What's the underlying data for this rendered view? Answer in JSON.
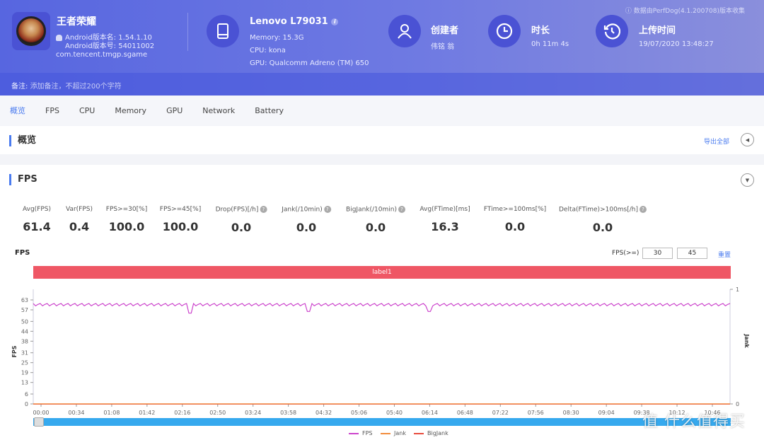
{
  "header": {
    "app": {
      "name": "王者荣耀",
      "version_name": "Android版本名: 1.54.1.10",
      "version_code": "Android版本号: 54011002",
      "package": "com.tencent.tmgp.sgame"
    },
    "device": {
      "name": "Lenovo L79031",
      "memory": "Memory: 15.3G",
      "cpu": "CPU: kona",
      "gpu": "GPU: Qualcomm Adreno (TM) 650"
    },
    "creator": {
      "title": "创建者",
      "value": "伟铭 翁"
    },
    "duration": {
      "title": "时长",
      "value": "0h 11m 4s"
    },
    "upload": {
      "title": "上传时间",
      "value": "19/07/2020 13:48:27"
    },
    "perfdog_note": "数据由PerfDog(4.1.200708)版本收集",
    "note_label": "备注:",
    "note_placeholder": "添加备注，不超过200个字符"
  },
  "tabs": [
    {
      "label": "概览",
      "active": true
    },
    {
      "label": "FPS",
      "active": false
    },
    {
      "label": "CPU",
      "active": false
    },
    {
      "label": "Memory",
      "active": false
    },
    {
      "label": "GPU",
      "active": false
    },
    {
      "label": "Network",
      "active": false
    },
    {
      "label": "Battery",
      "active": false
    }
  ],
  "overview": {
    "title": "概览",
    "export_label": "导出全部"
  },
  "fps_section": {
    "title": "FPS",
    "metrics": [
      {
        "label": "Avg(FPS)",
        "value": "61.4",
        "help": false
      },
      {
        "label": "Var(FPS)",
        "value": "0.4",
        "help": false
      },
      {
        "label": "FPS>=30[%]",
        "value": "100.0",
        "help": false
      },
      {
        "label": "FPS>=45[%]",
        "value": "100.0",
        "help": false
      },
      {
        "label": "Drop(FPS)[/h]",
        "value": "0.0",
        "help": true
      },
      {
        "label": "Jank(/10min)",
        "value": "0.0",
        "help": true
      },
      {
        "label": "BigJank(/10min)",
        "value": "0.0",
        "help": true
      },
      {
        "label": "Avg(FTime)[ms]",
        "value": "16.3",
        "help": false
      },
      {
        "label": "FTime>=100ms[%]",
        "value": "0.0",
        "help": false
      },
      {
        "label": "Delta(FTime)>100ms[/h]",
        "value": "0.0",
        "help": true
      }
    ],
    "chart_title": "FPS",
    "threshold_label": "FPS(>=)",
    "threshold_1": "30",
    "threshold_2": "45",
    "reset_label": "重置",
    "label_bar": "label1"
  },
  "chart_data": {
    "type": "line",
    "title": "FPS",
    "xlabel": "",
    "ylabel": "FPS",
    "y2label": "Jank",
    "ylim": [
      0,
      63
    ],
    "y2lim": [
      0,
      1
    ],
    "yticks": [
      "0",
      "6",
      "13",
      "19",
      "25",
      "31",
      "38",
      "44",
      "50",
      "57",
      "63"
    ],
    "y2ticks": [
      "0",
      "1"
    ],
    "xticks": [
      "00:00",
      "00:34",
      "01:08",
      "01:42",
      "02:16",
      "02:50",
      "03:24",
      "03:58",
      "04:32",
      "05:06",
      "05:40",
      "06:14",
      "06:48",
      "07:22",
      "07:56",
      "08:30",
      "09:04",
      "09:38",
      "10:12",
      "10:46"
    ],
    "duration_seconds": 664,
    "series": [
      {
        "name": "FPS",
        "color": "#cc44cc",
        "base": 60,
        "dips": [
          {
            "t": 150,
            "v": 55
          },
          {
            "t": 263,
            "v": 56
          },
          {
            "t": 378,
            "v": 56
          }
        ]
      },
      {
        "name": "Jank",
        "color": "#f28c3c",
        "value": 0
      },
      {
        "name": "BigJank",
        "color": "#e84c3d",
        "value": 0
      }
    ],
    "legend_position": "bottom-right",
    "grid": false
  },
  "watermark": "值 什么值得买"
}
